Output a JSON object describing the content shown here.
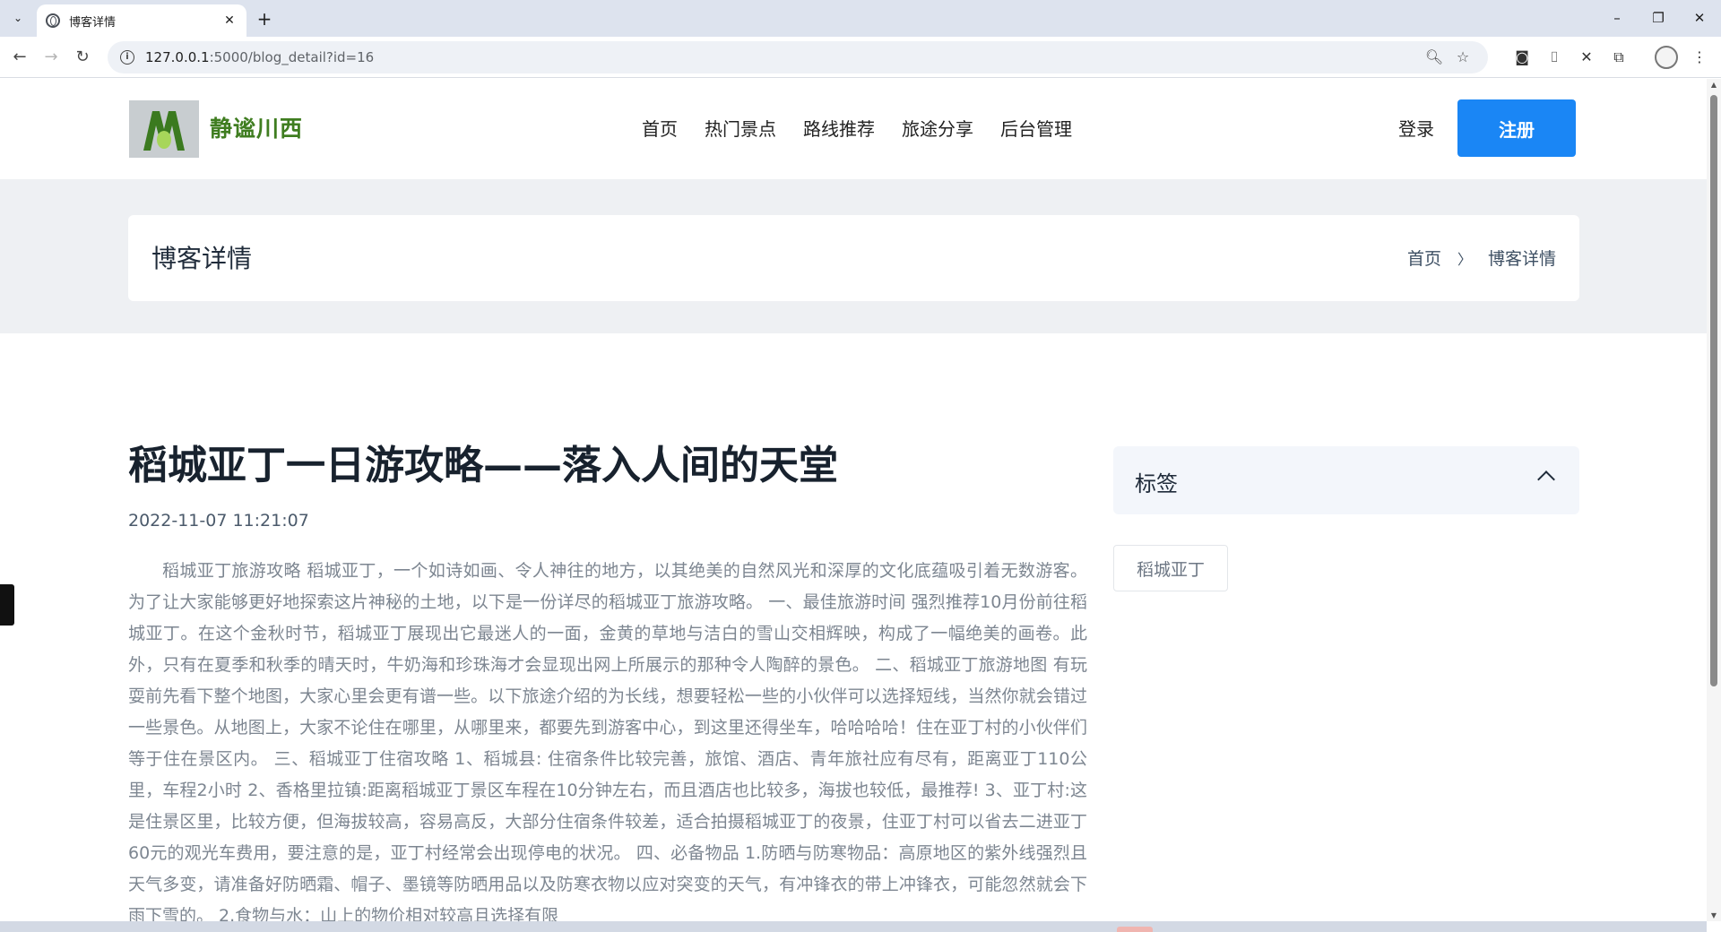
{
  "browser": {
    "tab_title": "博客详情",
    "url_host": "127.0.0.1",
    "url_rest": ":5000/blog_detail?id=16",
    "icons": {
      "tab_menu": "chevron-down-icon",
      "favicon": "globe-icon",
      "close": "close-icon",
      "new_tab": "plus-icon",
      "back": "arrow-left-icon",
      "forward": "arrow-right-icon",
      "reload": "reload-icon",
      "site_info": "info-icon",
      "zoom": "zoom-icon",
      "bookmark_star": "star-icon"
    }
  },
  "site": {
    "brand": "静谧川西",
    "brand_color": "#3f7d20",
    "nav": [
      "首页",
      "热门景点",
      "路线推荐",
      "旅途分享",
      "后台管理"
    ],
    "login": "登录",
    "register": "注册",
    "accent": "#1a86f5"
  },
  "breadcrumb": {
    "title": "博客详情",
    "home": "首页",
    "current": "博客详情"
  },
  "article": {
    "title": "稻城亚丁一日游攻略——落入人间的天堂",
    "date": "2022-11-07 11:21:07",
    "body": "稻城亚丁旅游攻略 稻城亚丁，一个如诗如画、令人神往的地方，以其绝美的自然风光和深厚的文化底蕴吸引着无数游客。为了让大家能够更好地探索这片神秘的土地，以下是一份详尽的稻城亚丁旅游攻略。 一、最佳旅游时间 强烈推荐10月份前往稻城亚丁。在这个金秋时节，稻城亚丁展现出它最迷人的一面，金黄的草地与洁白的雪山交相辉映，构成了一幅绝美的画卷。此外，只有在夏季和秋季的晴天时，牛奶海和珍珠海才会显现出网上所展示的那种令人陶醉的景色。 二、稻城亚丁旅游地图 有玩耍前先看下整个地图，大家心里会更有谱一些。以下旅途介绍的为长线，想要轻松一些的小伙伴可以选择短线，当然你就会错过一些景色。从地图上，大家不论住在哪里，从哪里来，都要先到游客中心，到这里还得坐车，哈哈哈哈！住在亚丁村的小伙伴们等于住在景区内。 三、稻城亚丁住宿攻略 1、稻城县: 住宿条件比较完善，旅馆、酒店、青年旅社应有尽有，距离亚丁110公里，车程2小时 2、香格里拉镇:距离稻城亚丁景区车程在10分钟左右，而且酒店也比较多，海拔也较低，最推荐! 3、亚丁村:这是住景区里，比较方便，但海拔较高，容易高反，大部分住宿条件较差，适合拍摄稻城亚丁的夜景，住亚丁村可以省去二进亚丁60元的观光车费用，要注意的是，亚丁村经常会出现停电的状况。 四、必备物品 1.防晒与防寒物品：高原地区的紫外线强烈且天气多变，请准备好防晒霜、帽子、墨镜等防晒用品以及防寒衣物以应对突变的天气，有冲锋衣的带上冲锋衣，可能忽然就会下雨下雪的。 2.食物与水：山上的物价相对较高且选择有限"
  },
  "sidebar": {
    "widget_title": "标签",
    "tags": [
      "稻城亚丁"
    ]
  }
}
